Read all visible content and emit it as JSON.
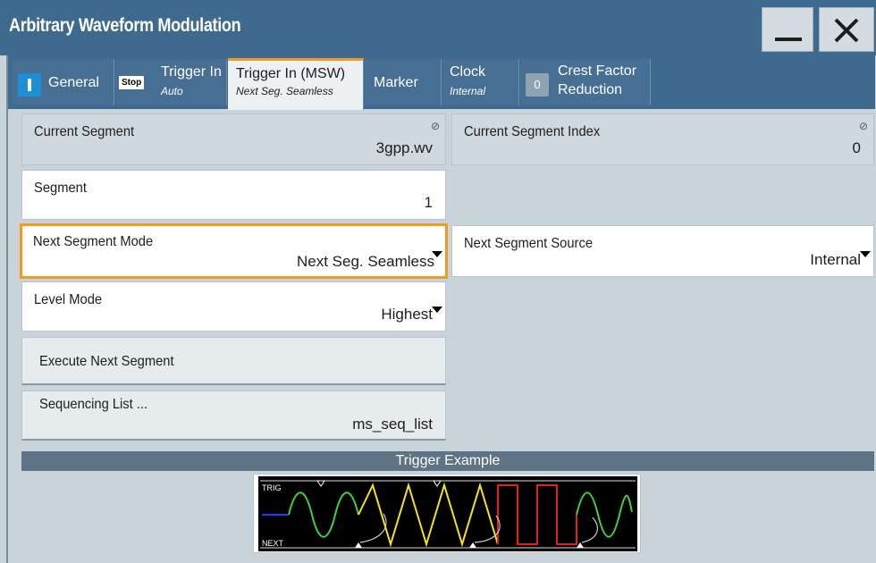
{
  "window": {
    "title": "Arbitrary Waveform Modulation",
    "minimize_icon": "minimize-icon",
    "close_icon": "close-icon"
  },
  "tabs": [
    {
      "label": "General",
      "sub": "",
      "indicator": "on-indicator"
    },
    {
      "label": "Trigger In",
      "sub": "Auto",
      "indicator": "Stop"
    },
    {
      "label": "Trigger In (MSW)",
      "sub": "Next Seg. Seamless",
      "active": true
    },
    {
      "label": "Marker",
      "sub": ""
    },
    {
      "label": "Clock",
      "sub": "Internal"
    },
    {
      "label": "Crest Factor",
      "label2": "Reduction",
      "indicator": "0"
    }
  ],
  "fields": {
    "current_segment": {
      "label": "Current Segment",
      "value": "3gpp.wv"
    },
    "current_segment_index": {
      "label": "Current Segment Index",
      "value": "0"
    },
    "segment": {
      "label": "Segment",
      "value": "1"
    },
    "next_segment_mode": {
      "label": "Next Segment Mode",
      "value": "Next Seg. Seamless"
    },
    "next_segment_source": {
      "label": "Next Segment Source",
      "value": "Internal"
    },
    "level_mode": {
      "label": "Level Mode",
      "value": "Highest"
    }
  },
  "buttons": {
    "execute_next_segment": {
      "label": "Execute Next Segment"
    },
    "sequencing_list": {
      "label": "Sequencing List ...",
      "value": "ms_seq_list"
    }
  },
  "example": {
    "header": "Trigger Example",
    "trig_label": "TRIG",
    "next_label": "NEXT"
  },
  "colors": {
    "titlebar": "#3d6a8e",
    "tab_active_accent": "#f29a1f",
    "focus_border": "#f29a1f",
    "wave_green": "#3fd03f",
    "wave_yellow": "#f4e21a",
    "wave_red": "#e01f1f"
  }
}
